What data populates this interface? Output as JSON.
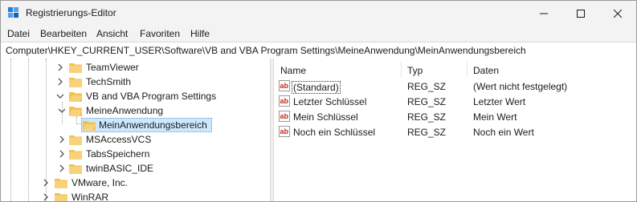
{
  "window": {
    "title": "Registrierungs-Editor"
  },
  "menu": [
    "Datei",
    "Bearbeiten",
    "Ansicht",
    "Favoriten",
    "Hilfe"
  ],
  "address": "Computer\\HKEY_CURRENT_USER\\Software\\VB and VBA Program Settings\\MeineAnwendung\\MeinAnwendungsbereich",
  "tree": [
    {
      "label": "TeamViewer",
      "expanded": false
    },
    {
      "label": "TechSmith",
      "expanded": false
    },
    {
      "label": "VB and VBA Program Settings",
      "expanded": true
    },
    {
      "label": "MeineAnwendung",
      "expanded": true
    },
    {
      "label": "MeinAnwendungsbereich",
      "selected": true
    },
    {
      "label": "MSAccessVCS",
      "expanded": false
    },
    {
      "label": "TabsSpeichern",
      "expanded": false
    },
    {
      "label": "twinBASIC_IDE",
      "expanded": false
    },
    {
      "label": "VMware, Inc.",
      "expanded": false
    },
    {
      "label": "WinRAR",
      "expanded": false
    }
  ],
  "columns": {
    "name": "Name",
    "type": "Typ",
    "data": "Daten"
  },
  "values": [
    {
      "name": "(Standard)",
      "type": "REG_SZ",
      "data": "(Wert nicht festgelegt)"
    },
    {
      "name": "Letzter Schlüssel",
      "type": "REG_SZ",
      "data": "Letzter Wert"
    },
    {
      "name": "Mein Schlüssel",
      "type": "REG_SZ",
      "data": "Mein Wert"
    },
    {
      "name": "Noch ein Schlüssel",
      "type": "REG_SZ",
      "data": "Noch ein Wert"
    }
  ],
  "colors": {
    "selection": "#cce8ff",
    "folder": "#f2c14e",
    "string_icon": "#c42b1c"
  },
  "icons": {
    "app": "registry-editor-icon",
    "folder": "folder-icon",
    "value": "string-value-icon"
  }
}
